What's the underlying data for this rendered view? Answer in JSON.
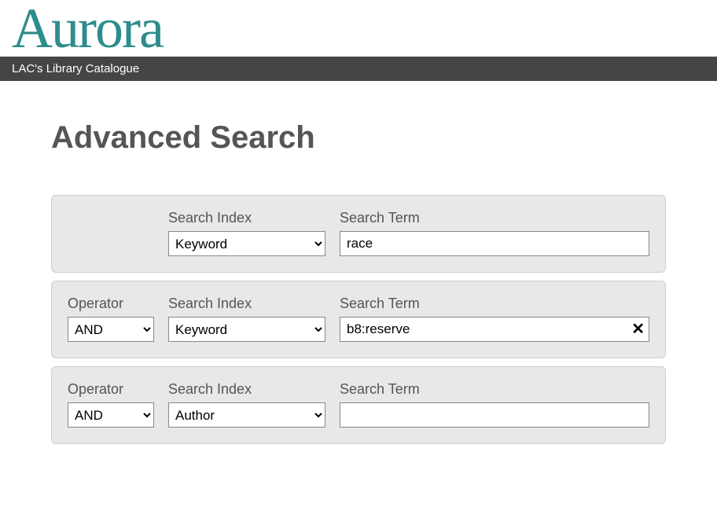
{
  "brand": {
    "logo_text": "Aurora",
    "subtitle": "LAC's Library Catalogue"
  },
  "page": {
    "title": "Advanced Search"
  },
  "labels": {
    "operator": "Operator",
    "search_index": "Search Index",
    "search_term": "Search Term"
  },
  "rows": [
    {
      "operator": null,
      "index": "Keyword",
      "term": "race",
      "show_clear": false
    },
    {
      "operator": "AND",
      "index": "Keyword",
      "term": "b8:reserve",
      "show_clear": true
    },
    {
      "operator": "AND",
      "index": "Author",
      "term": "",
      "show_clear": false
    }
  ]
}
